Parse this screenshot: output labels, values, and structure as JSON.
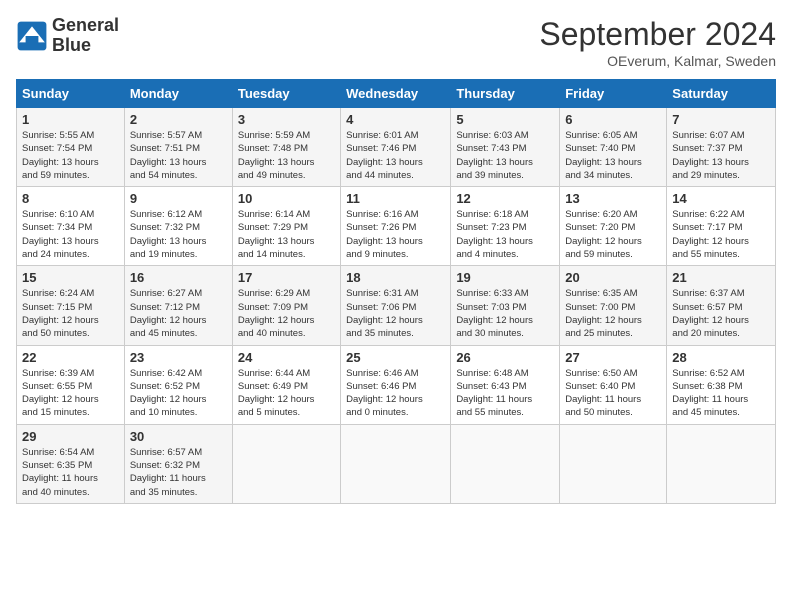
{
  "header": {
    "logo_line1": "General",
    "logo_line2": "Blue",
    "month": "September 2024",
    "location": "OEverum, Kalmar, Sweden"
  },
  "days_of_week": [
    "Sunday",
    "Monday",
    "Tuesday",
    "Wednesday",
    "Thursday",
    "Friday",
    "Saturday"
  ],
  "weeks": [
    [
      {
        "day": "1",
        "info": "Sunrise: 5:55 AM\nSunset: 7:54 PM\nDaylight: 13 hours\nand 59 minutes."
      },
      {
        "day": "2",
        "info": "Sunrise: 5:57 AM\nSunset: 7:51 PM\nDaylight: 13 hours\nand 54 minutes."
      },
      {
        "day": "3",
        "info": "Sunrise: 5:59 AM\nSunset: 7:48 PM\nDaylight: 13 hours\nand 49 minutes."
      },
      {
        "day": "4",
        "info": "Sunrise: 6:01 AM\nSunset: 7:46 PM\nDaylight: 13 hours\nand 44 minutes."
      },
      {
        "day": "5",
        "info": "Sunrise: 6:03 AM\nSunset: 7:43 PM\nDaylight: 13 hours\nand 39 minutes."
      },
      {
        "day": "6",
        "info": "Sunrise: 6:05 AM\nSunset: 7:40 PM\nDaylight: 13 hours\nand 34 minutes."
      },
      {
        "day": "7",
        "info": "Sunrise: 6:07 AM\nSunset: 7:37 PM\nDaylight: 13 hours\nand 29 minutes."
      }
    ],
    [
      {
        "day": "8",
        "info": "Sunrise: 6:10 AM\nSunset: 7:34 PM\nDaylight: 13 hours\nand 24 minutes."
      },
      {
        "day": "9",
        "info": "Sunrise: 6:12 AM\nSunset: 7:32 PM\nDaylight: 13 hours\nand 19 minutes."
      },
      {
        "day": "10",
        "info": "Sunrise: 6:14 AM\nSunset: 7:29 PM\nDaylight: 13 hours\nand 14 minutes."
      },
      {
        "day": "11",
        "info": "Sunrise: 6:16 AM\nSunset: 7:26 PM\nDaylight: 13 hours\nand 9 minutes."
      },
      {
        "day": "12",
        "info": "Sunrise: 6:18 AM\nSunset: 7:23 PM\nDaylight: 13 hours\nand 4 minutes."
      },
      {
        "day": "13",
        "info": "Sunrise: 6:20 AM\nSunset: 7:20 PM\nDaylight: 12 hours\nand 59 minutes."
      },
      {
        "day": "14",
        "info": "Sunrise: 6:22 AM\nSunset: 7:17 PM\nDaylight: 12 hours\nand 55 minutes."
      }
    ],
    [
      {
        "day": "15",
        "info": "Sunrise: 6:24 AM\nSunset: 7:15 PM\nDaylight: 12 hours\nand 50 minutes."
      },
      {
        "day": "16",
        "info": "Sunrise: 6:27 AM\nSunset: 7:12 PM\nDaylight: 12 hours\nand 45 minutes."
      },
      {
        "day": "17",
        "info": "Sunrise: 6:29 AM\nSunset: 7:09 PM\nDaylight: 12 hours\nand 40 minutes."
      },
      {
        "day": "18",
        "info": "Sunrise: 6:31 AM\nSunset: 7:06 PM\nDaylight: 12 hours\nand 35 minutes."
      },
      {
        "day": "19",
        "info": "Sunrise: 6:33 AM\nSunset: 7:03 PM\nDaylight: 12 hours\nand 30 minutes."
      },
      {
        "day": "20",
        "info": "Sunrise: 6:35 AM\nSunset: 7:00 PM\nDaylight: 12 hours\nand 25 minutes."
      },
      {
        "day": "21",
        "info": "Sunrise: 6:37 AM\nSunset: 6:57 PM\nDaylight: 12 hours\nand 20 minutes."
      }
    ],
    [
      {
        "day": "22",
        "info": "Sunrise: 6:39 AM\nSunset: 6:55 PM\nDaylight: 12 hours\nand 15 minutes."
      },
      {
        "day": "23",
        "info": "Sunrise: 6:42 AM\nSunset: 6:52 PM\nDaylight: 12 hours\nand 10 minutes."
      },
      {
        "day": "24",
        "info": "Sunrise: 6:44 AM\nSunset: 6:49 PM\nDaylight: 12 hours\nand 5 minutes."
      },
      {
        "day": "25",
        "info": "Sunrise: 6:46 AM\nSunset: 6:46 PM\nDaylight: 12 hours\nand 0 minutes."
      },
      {
        "day": "26",
        "info": "Sunrise: 6:48 AM\nSunset: 6:43 PM\nDaylight: 11 hours\nand 55 minutes."
      },
      {
        "day": "27",
        "info": "Sunrise: 6:50 AM\nSunset: 6:40 PM\nDaylight: 11 hours\nand 50 minutes."
      },
      {
        "day": "28",
        "info": "Sunrise: 6:52 AM\nSunset: 6:38 PM\nDaylight: 11 hours\nand 45 minutes."
      }
    ],
    [
      {
        "day": "29",
        "info": "Sunrise: 6:54 AM\nSunset: 6:35 PM\nDaylight: 11 hours\nand 40 minutes."
      },
      {
        "day": "30",
        "info": "Sunrise: 6:57 AM\nSunset: 6:32 PM\nDaylight: 11 hours\nand 35 minutes."
      },
      {
        "day": "",
        "info": ""
      },
      {
        "day": "",
        "info": ""
      },
      {
        "day": "",
        "info": ""
      },
      {
        "day": "",
        "info": ""
      },
      {
        "day": "",
        "info": ""
      }
    ]
  ]
}
